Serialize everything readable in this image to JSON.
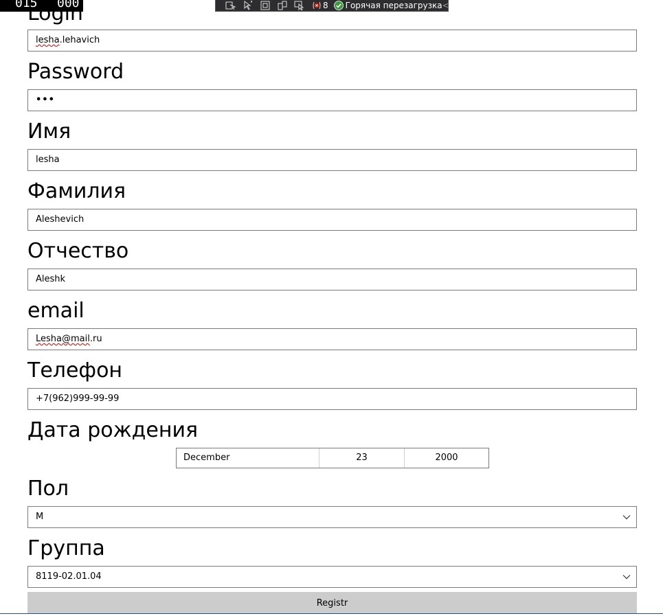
{
  "debug": {
    "frame_counter_left": "015",
    "frame_counter_right": "000",
    "toolbar_error_count": "8",
    "toolbar_hot_reload_label": "Горячая перезагрузка",
    "toolbar_collapse_glyph": "<"
  },
  "form": {
    "login": {
      "label": "Login",
      "value_part1": "lesha",
      "value_part2": ".lehavich"
    },
    "password": {
      "label": "Password",
      "masked_value": "•••"
    },
    "first_name": {
      "label": "Имя",
      "value": "lesha"
    },
    "last_name": {
      "label": "Фамилия",
      "value": "Aleshevich"
    },
    "middle_name": {
      "label": "Отчество",
      "value": "Aleshk"
    },
    "email": {
      "label": "email",
      "value_part1": "Lesha@mail",
      "value_part2": ".ru"
    },
    "phone": {
      "label": "Телефон",
      "value": "+7(962)999-99-99"
    },
    "birth_date": {
      "label": "Дата рождения",
      "month": "December",
      "day": "23",
      "year": "2000"
    },
    "gender": {
      "label": "Пол",
      "selected": "М"
    },
    "group": {
      "label": "Группа",
      "selected": "8119-02.01.04"
    },
    "submit_label": "Registr"
  },
  "colors": {
    "field_border": "#7a7a7a",
    "button_bg": "#cccccc",
    "toolbar_bg": "#2d2d30",
    "hot_reload_ok": "#3c9a3c"
  },
  "icons": {
    "select_arrow": "chevron-down-icon",
    "hot_reload_status": "check-circle-icon"
  }
}
